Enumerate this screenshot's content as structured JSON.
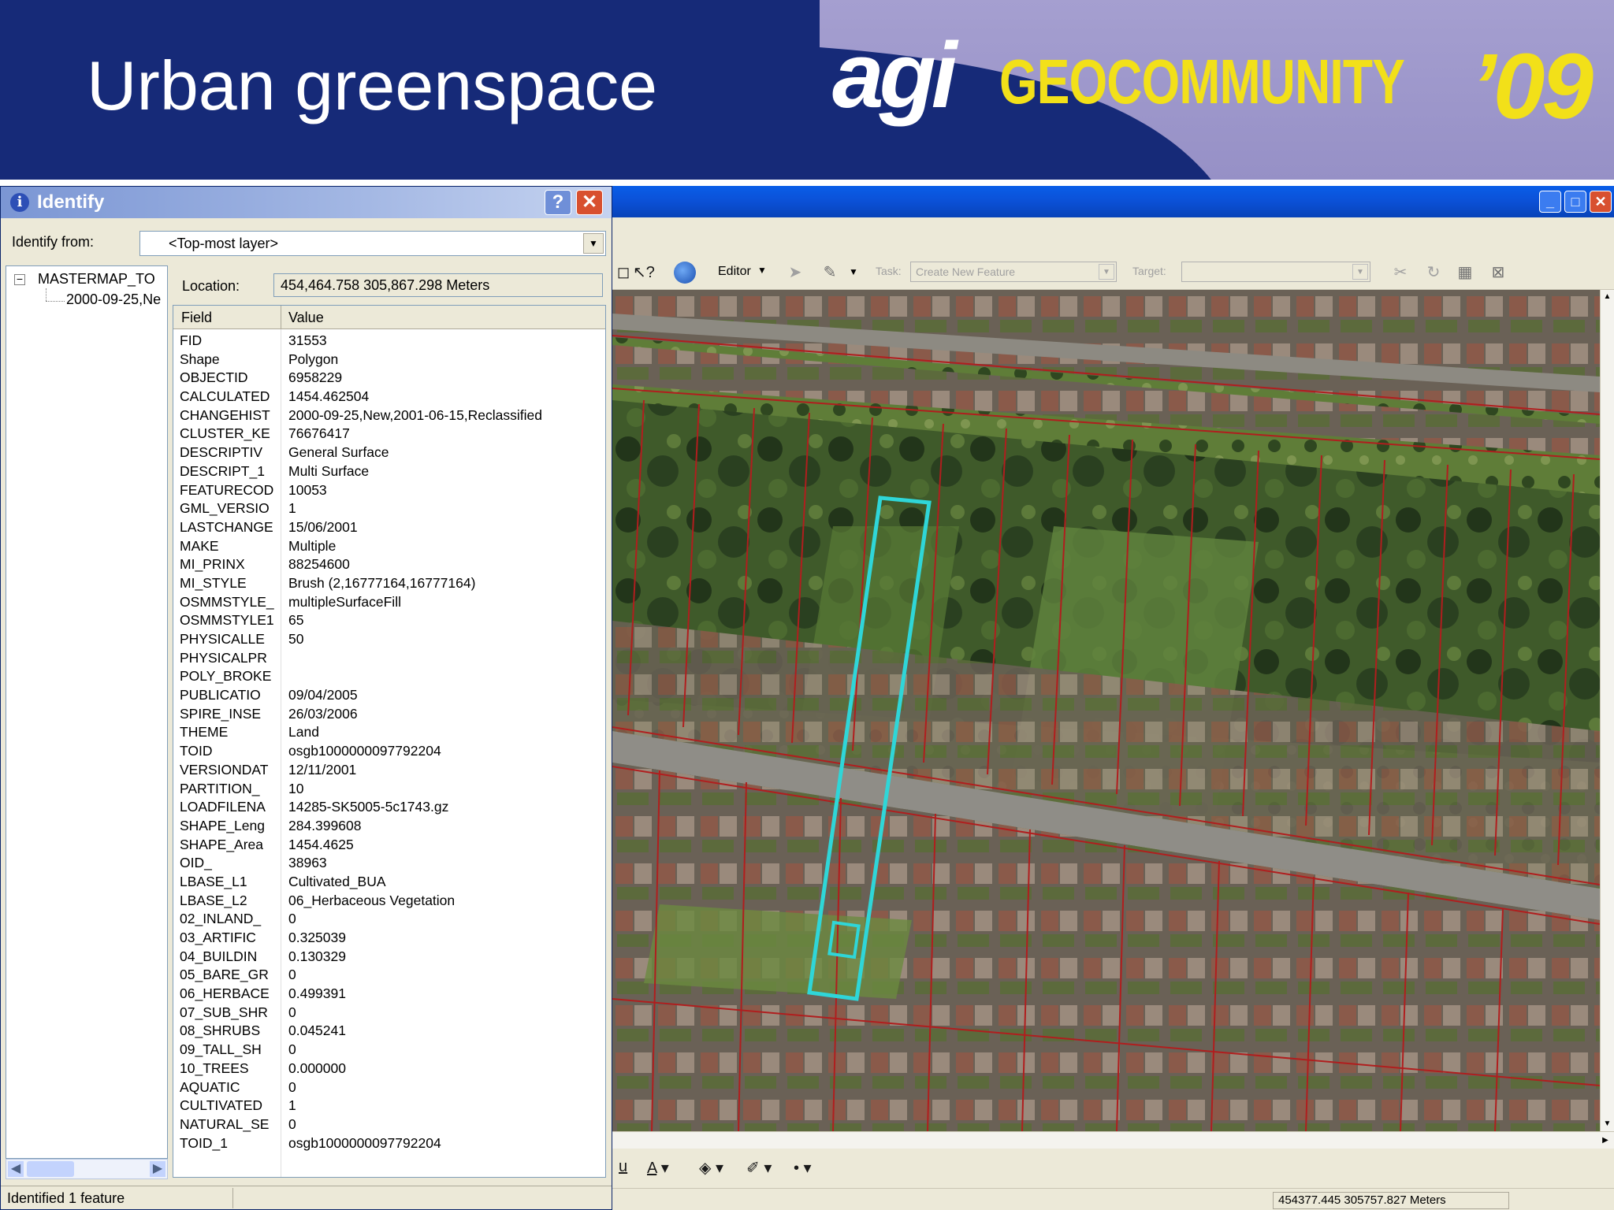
{
  "slide": {
    "title": "Urban greenspace",
    "logo": {
      "agi": "agi",
      "geo": "GEOCOMMUNITY",
      "year": "’09"
    },
    "colors": {
      "banner_blue": "#162a78",
      "banner_lilac": "#a59fd0",
      "logo_yellow": "#f2e019"
    }
  },
  "identify": {
    "title": "Identify",
    "help_label": "?",
    "close_label": "✕",
    "identify_from_label": "Identify from:",
    "identify_from_value": "<Top-most layer>",
    "tree": {
      "expander": "−",
      "root": "MASTERMAP_TO",
      "child": "2000-09-25,Ne"
    },
    "location_label": "Location:",
    "location_value": "454,464.758  305,867.298 Meters",
    "columns": {
      "field": "Field",
      "value": "Value"
    },
    "rows": [
      {
        "field": "FID",
        "value": "31553"
      },
      {
        "field": "Shape",
        "value": "Polygon"
      },
      {
        "field": "OBJECTID",
        "value": "6958229"
      },
      {
        "field": "CALCULATED",
        "value": "1454.462504"
      },
      {
        "field": "CHANGEHIST",
        "value": "2000-09-25,New,2001-06-15,Reclassified"
      },
      {
        "field": "CLUSTER_KE",
        "value": "76676417"
      },
      {
        "field": "DESCRIPTIV",
        "value": "General Surface"
      },
      {
        "field": "DESCRIPT_1",
        "value": "Multi Surface"
      },
      {
        "field": "FEATURECOD",
        "value": "10053"
      },
      {
        "field": "GML_VERSIO",
        "value": "1"
      },
      {
        "field": "LASTCHANGE",
        "value": "15/06/2001"
      },
      {
        "field": "MAKE",
        "value": "Multiple"
      },
      {
        "field": "MI_PRINX",
        "value": "88254600"
      },
      {
        "field": "MI_STYLE",
        "value": "Brush (2,16777164,16777164)"
      },
      {
        "field": "OSMMSTYLE_",
        "value": "multipleSurfaceFill"
      },
      {
        "field": "OSMMSTYLE1",
        "value": "65"
      },
      {
        "field": "PHYSICALLE",
        "value": "50"
      },
      {
        "field": "PHYSICALPR",
        "value": ""
      },
      {
        "field": "POLY_BROKE",
        "value": ""
      },
      {
        "field": "PUBLICATIO",
        "value": "09/04/2005"
      },
      {
        "field": "SPIRE_INSE",
        "value": "26/03/2006"
      },
      {
        "field": "THEME",
        "value": "Land"
      },
      {
        "field": "TOID",
        "value": "osgb1000000097792204"
      },
      {
        "field": "VERSIONDAT",
        "value": "12/11/2001"
      },
      {
        "field": "PARTITION_",
        "value": "10"
      },
      {
        "field": "LOADFILENA",
        "value": "14285-SK5005-5c1743.gz"
      },
      {
        "field": "SHAPE_Leng",
        "value": "284.399608"
      },
      {
        "field": "SHAPE_Area",
        "value": "1454.4625"
      },
      {
        "field": "OID_",
        "value": "38963"
      },
      {
        "field": "LBASE_L1",
        "value": "Cultivated_BUA"
      },
      {
        "field": "LBASE_L2",
        "value": "06_Herbaceous Vegetation"
      },
      {
        "field": "02_INLAND_",
        "value": "0"
      },
      {
        "field": "03_ARTIFIC",
        "value": "0.325039"
      },
      {
        "field": "04_BUILDIN",
        "value": "0.130329"
      },
      {
        "field": "05_BARE_GR",
        "value": "0"
      },
      {
        "field": "06_HERBACE",
        "value": "0.499391"
      },
      {
        "field": "07_SUB_SHR",
        "value": "0"
      },
      {
        "field": "08_SHRUBS",
        "value": "0.045241"
      },
      {
        "field": "09_TALL_SH",
        "value": "0"
      },
      {
        "field": "10_TREES",
        "value": "0.000000"
      },
      {
        "field": "AQUATIC",
        "value": "0"
      },
      {
        "field": "CULTIVATED",
        "value": "1"
      },
      {
        "field": "NATURAL_SE",
        "value": "0"
      },
      {
        "field": "TOID_1",
        "value": "osgb1000000097792204"
      }
    ],
    "status_text": "Identified 1 feature"
  },
  "arcmap": {
    "title_buttons": {
      "minimize": "_",
      "maximize": "□",
      "close": "✕"
    },
    "toolbar": {
      "editor_label": "Editor",
      "task_label": "Task:",
      "task_value": "Create New Feature",
      "target_label": "Target:"
    },
    "status_coords": "454377.445  305757.827 Meters",
    "colors": {
      "highlight_cyan": "#2fd6d8",
      "parcel_red": "#b01e1e"
    }
  }
}
